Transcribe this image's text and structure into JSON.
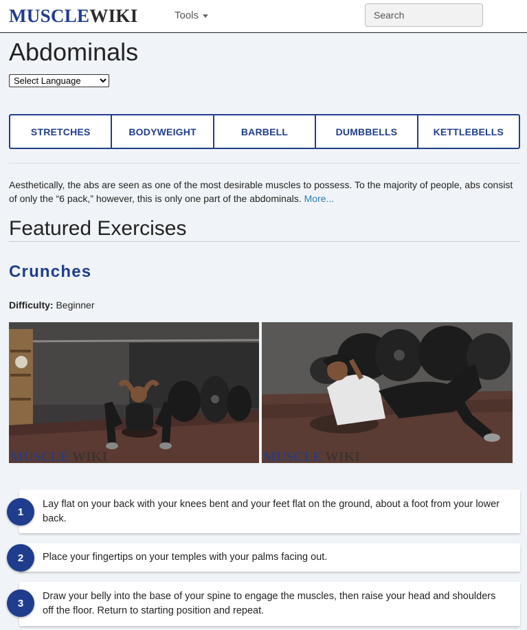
{
  "brand": {
    "logo_part1": "MUSCLE",
    "logo_part2": "WIKI"
  },
  "nav": {
    "tools_label": "Tools"
  },
  "search": {
    "placeholder": "Search"
  },
  "page": {
    "title": "Abdominals",
    "language_select": "Select Language"
  },
  "categories": [
    "STRETCHES",
    "BODYWEIGHT",
    "BARBELL",
    "DUMBBELLS",
    "KETTLEBELLS"
  ],
  "description": {
    "text": "Aesthetically, the abs are seen as one of the most desirable muscles to possess. To the majority of people, abs consist of only the “6 pack,” however, this is only one part of the abdominals. ",
    "more_link": "More..."
  },
  "featured": {
    "title": "Featured Exercises"
  },
  "exercise": {
    "name": "Crunches",
    "difficulty_label": "Difficulty:",
    "difficulty_value": "Beginner",
    "watermark_part1": "MUSCLE",
    "watermark_part2": "WIKI",
    "steps": [
      {
        "number": "1",
        "text": "Lay flat on your back with your knees bent and your feet flat on the ground, about a foot from your lower back."
      },
      {
        "number": "2",
        "text": "Place your fingertips on your temples with your palms facing out."
      },
      {
        "number": "3",
        "text": "Draw your belly into the base of your spine to engage the muscles, then raise your head and shoulders off the floor. Return to starting position and repeat."
      }
    ]
  },
  "colors": {
    "brand_blue": "#1f3d8c",
    "link": "#2a7ab8",
    "background": "#f0f4f8"
  }
}
